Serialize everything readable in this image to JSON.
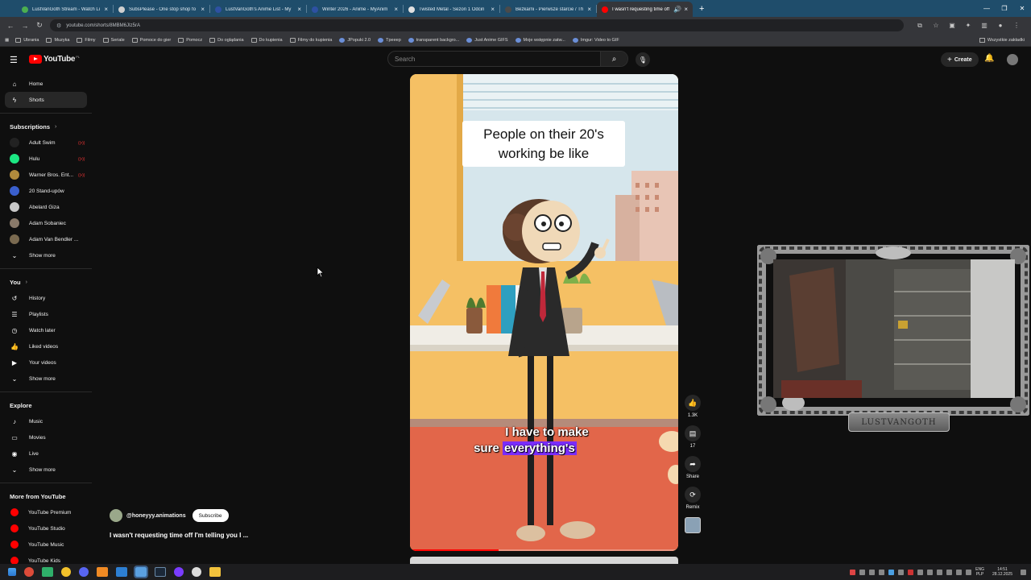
{
  "browser": {
    "tabs": [
      {
        "label": "LustVanGoth Stream - Watch Li",
        "color": "#4caf50",
        "active": false
      },
      {
        "label": "SubsPlease - One stop shop fo",
        "color": "#cfcfcf",
        "active": false
      },
      {
        "label": "LustVanGoth's Anime List - My",
        "color": "#2e51a2",
        "active": false
      },
      {
        "label": "Winter 2026 - Anime - MyAnim",
        "color": "#2e51a2",
        "active": false
      },
      {
        "label": "Twisted Metal - Sezon 1 Odcin",
        "color": "#e0e0e0",
        "active": false
      },
      {
        "label": "Bezkarni - Pierwsze starcie / Th",
        "color": "#4a4a4a",
        "active": false
      },
      {
        "label": "I wasn't requesting time off",
        "color": "#ff0000",
        "active": true
      }
    ],
    "new_tab": "+",
    "url": "youtube.com/shorts/8MBM6JIz5rA",
    "bookmarks": [
      "Ubrania",
      "Muzyka",
      "Filmy",
      "Seriale",
      "Pomoce do gier",
      "Pomocz",
      "Do oglądania",
      "Do kupienia",
      "Filmy do kupienia",
      "JPopuki 2.0",
      "Tpeeep",
      "transparent backgro...",
      "Just Anime GIFS",
      "Moje wstępnie zatw...",
      "Imgur: Video to GIF"
    ],
    "bookmarks_right": "Wszystkie zakładki"
  },
  "youtube": {
    "logo": "YouTube",
    "country": "PL",
    "search_placeholder": "Search",
    "create": "Create",
    "sidebar": {
      "main": [
        {
          "label": "Home",
          "icon": "⌂",
          "active": false
        },
        {
          "label": "Shorts",
          "icon": "ϟ",
          "active": true
        }
      ],
      "subscriptions_header": "Subscriptions",
      "subscriptions": [
        {
          "label": "Adult Swim",
          "color": "#222222",
          "live": true
        },
        {
          "label": "Hulu",
          "color": "#1ce783",
          "live": true
        },
        {
          "label": "Warner Bros. Ent...",
          "color": "#b08a3c",
          "live": true
        },
        {
          "label": "20 Stand-upów",
          "color": "#3a5fcd",
          "live": false
        },
        {
          "label": "Abelard Giza",
          "color": "#c8c8c8",
          "live": false
        },
        {
          "label": "Adam Sobaniec",
          "color": "#8a7a6a",
          "live": false
        },
        {
          "label": "Adam Van Bendler ...",
          "color": "#7a6a50",
          "live": false
        }
      ],
      "subs_show_more": "Show more",
      "you_header": "You",
      "you": [
        {
          "label": "History",
          "icon": "↺"
        },
        {
          "label": "Playlists",
          "icon": "☰"
        },
        {
          "label": "Watch later",
          "icon": "◷"
        },
        {
          "label": "Liked videos",
          "icon": "👍"
        },
        {
          "label": "Your videos",
          "icon": "▶"
        }
      ],
      "you_show_more": "Show more",
      "explore_header": "Explore",
      "explore": [
        {
          "label": "Music",
          "icon": "♪"
        },
        {
          "label": "Movies",
          "icon": "▭"
        },
        {
          "label": "Live",
          "icon": "◉"
        }
      ],
      "explore_show_more": "Show more",
      "more_header": "More from YouTube",
      "more": [
        {
          "label": "YouTube Premium"
        },
        {
          "label": "YouTube Studio"
        },
        {
          "label": "YouTube Music"
        },
        {
          "label": "YouTube Kids"
        }
      ]
    },
    "short": {
      "caption": "People on their 20's working be like",
      "subtitle_line1": "I have to make",
      "subtitle_line2_plain": "sure",
      "subtitle_line2_highlight": "everything's",
      "progress_fraction": 0.33,
      "likes": "1.3K",
      "comments": "17",
      "share": "Share",
      "remix": "Remix",
      "channel": "@honeyyy.animations",
      "subscribe": "Subscribe",
      "title": "I wasn't requesting time off I'm telling you I ..."
    },
    "webcam_name": "LUSTVANGOTH"
  },
  "taskbar": {
    "lang": "ENG",
    "lang2": "PLP",
    "time": "14:51",
    "date": "28.12.2025"
  },
  "colors": {
    "accent_red": "#ff0000",
    "subtitle_highlight": "#7b2cff",
    "tabbar": "#1f4d6b"
  }
}
